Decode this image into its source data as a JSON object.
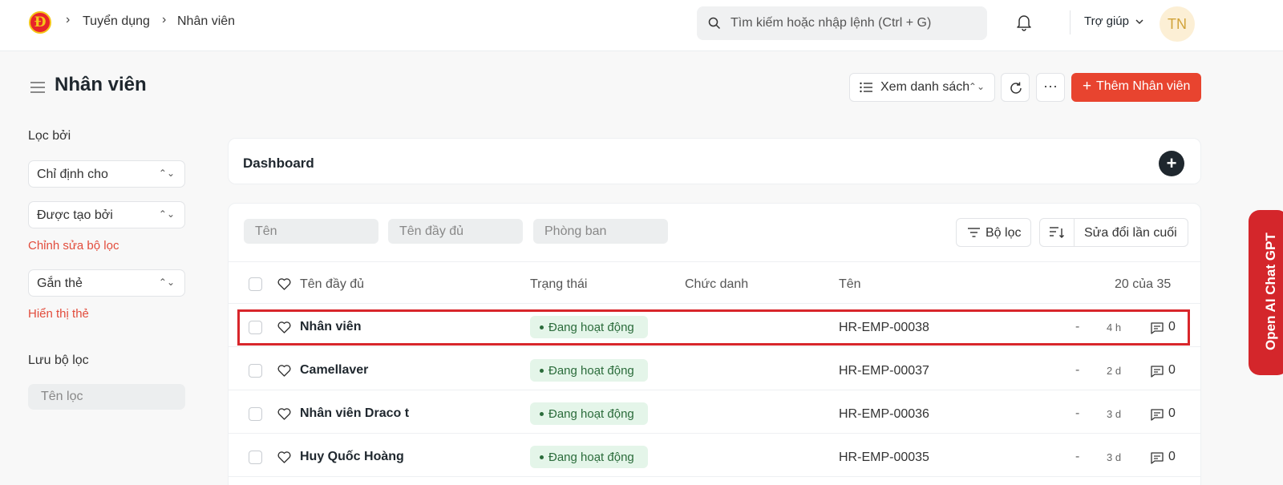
{
  "nav": {
    "logo_letter": "Đ",
    "breadcrumbs": [
      "Tuyển dụng",
      "Nhân viên"
    ],
    "search_placeholder": "Tìm kiếm hoặc nhập lệnh (Ctrl + G)",
    "help_label": "Trợ giúp",
    "avatar_initials": "TN"
  },
  "header": {
    "title": "Nhân viên",
    "view_label": "Xem danh sách",
    "more_label": "···",
    "primary_label": "Thêm Nhân viên"
  },
  "sidebar": {
    "filter_by": "Lọc bởi",
    "assigned_to": "Chỉ định cho",
    "created_by": "Được tạo bởi",
    "edit_filters": "Chỉnh sửa bộ lọc",
    "tags": "Gắn thẻ",
    "show_tags": "Hiển thị thẻ",
    "save_filter": "Lưu bộ lọc",
    "filter_name_placeholder": "Tên lọc"
  },
  "dashboard": {
    "label": "Dashboard"
  },
  "list": {
    "filters": {
      "name_placeholder": "Tên",
      "full_name_placeholder": "Tên đầy đủ",
      "department_placeholder": "Phòng ban"
    },
    "filter_button": "Bộ lọc",
    "sort_field": "Sửa đổi lần cuối",
    "columns": {
      "full_name": "Tên đầy đủ",
      "status": "Trạng thái",
      "designation": "Chức danh",
      "name": "Tên",
      "count": "20 của 35"
    },
    "rows": [
      {
        "full_name": "Nhân viên",
        "status": "Đang hoạt động",
        "id": "HR-EMP-00038",
        "dash": "-",
        "time": "4 h",
        "comments": "0"
      },
      {
        "full_name": "Camellaver",
        "status": "Đang hoạt động",
        "id": "HR-EMP-00037",
        "dash": "-",
        "time": "2 d",
        "comments": "0"
      },
      {
        "full_name": "Nhân viên Draco t",
        "status": "Đang hoạt động",
        "id": "HR-EMP-00036",
        "dash": "-",
        "time": "3 d",
        "comments": "0"
      },
      {
        "full_name": "Huy Quốc Hoàng",
        "status": "Đang hoạt động",
        "id": "HR-EMP-00035",
        "dash": "-",
        "time": "3 d",
        "comments": "0"
      }
    ]
  },
  "side_tab": {
    "label": "Open AI Chat GPT"
  },
  "colors": {
    "primary": "#e8442f",
    "highlight": "#d8262b",
    "status_bg": "#e4f5e9",
    "status_text": "#2b6c3b"
  }
}
